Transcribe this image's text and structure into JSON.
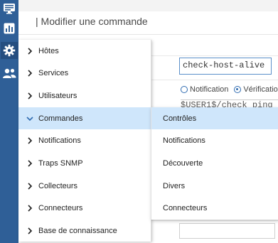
{
  "rail": {
    "icons": [
      "monitor-icon",
      "chart-icon",
      "gear-icon",
      "users-icon"
    ]
  },
  "page": {
    "title": "| Modifier une commande",
    "command_value": "check-host-alive",
    "radio_options": [
      "Notification",
      "Vérification"
    ],
    "command_line": "$USER1$/check_ping"
  },
  "menu": {
    "items": [
      {
        "label": "Hôtes"
      },
      {
        "label": "Services"
      },
      {
        "label": "Utilisateurs"
      },
      {
        "label": "Commandes"
      },
      {
        "label": "Notifications"
      },
      {
        "label": "Traps SNMP"
      },
      {
        "label": "Collecteurs"
      },
      {
        "label": "Connecteurs"
      },
      {
        "label": "Base de connaissance"
      }
    ],
    "active_index": 3
  },
  "submenu": {
    "items": [
      {
        "label": "Contrôles"
      },
      {
        "label": "Notifications"
      },
      {
        "label": "Découverte"
      },
      {
        "label": "Divers"
      },
      {
        "label": "Connecteurs"
      }
    ]
  },
  "colors": {
    "rail": "#2f5f97",
    "active_highlight": "#cfe6fb",
    "accent": "#2f6bb0"
  }
}
